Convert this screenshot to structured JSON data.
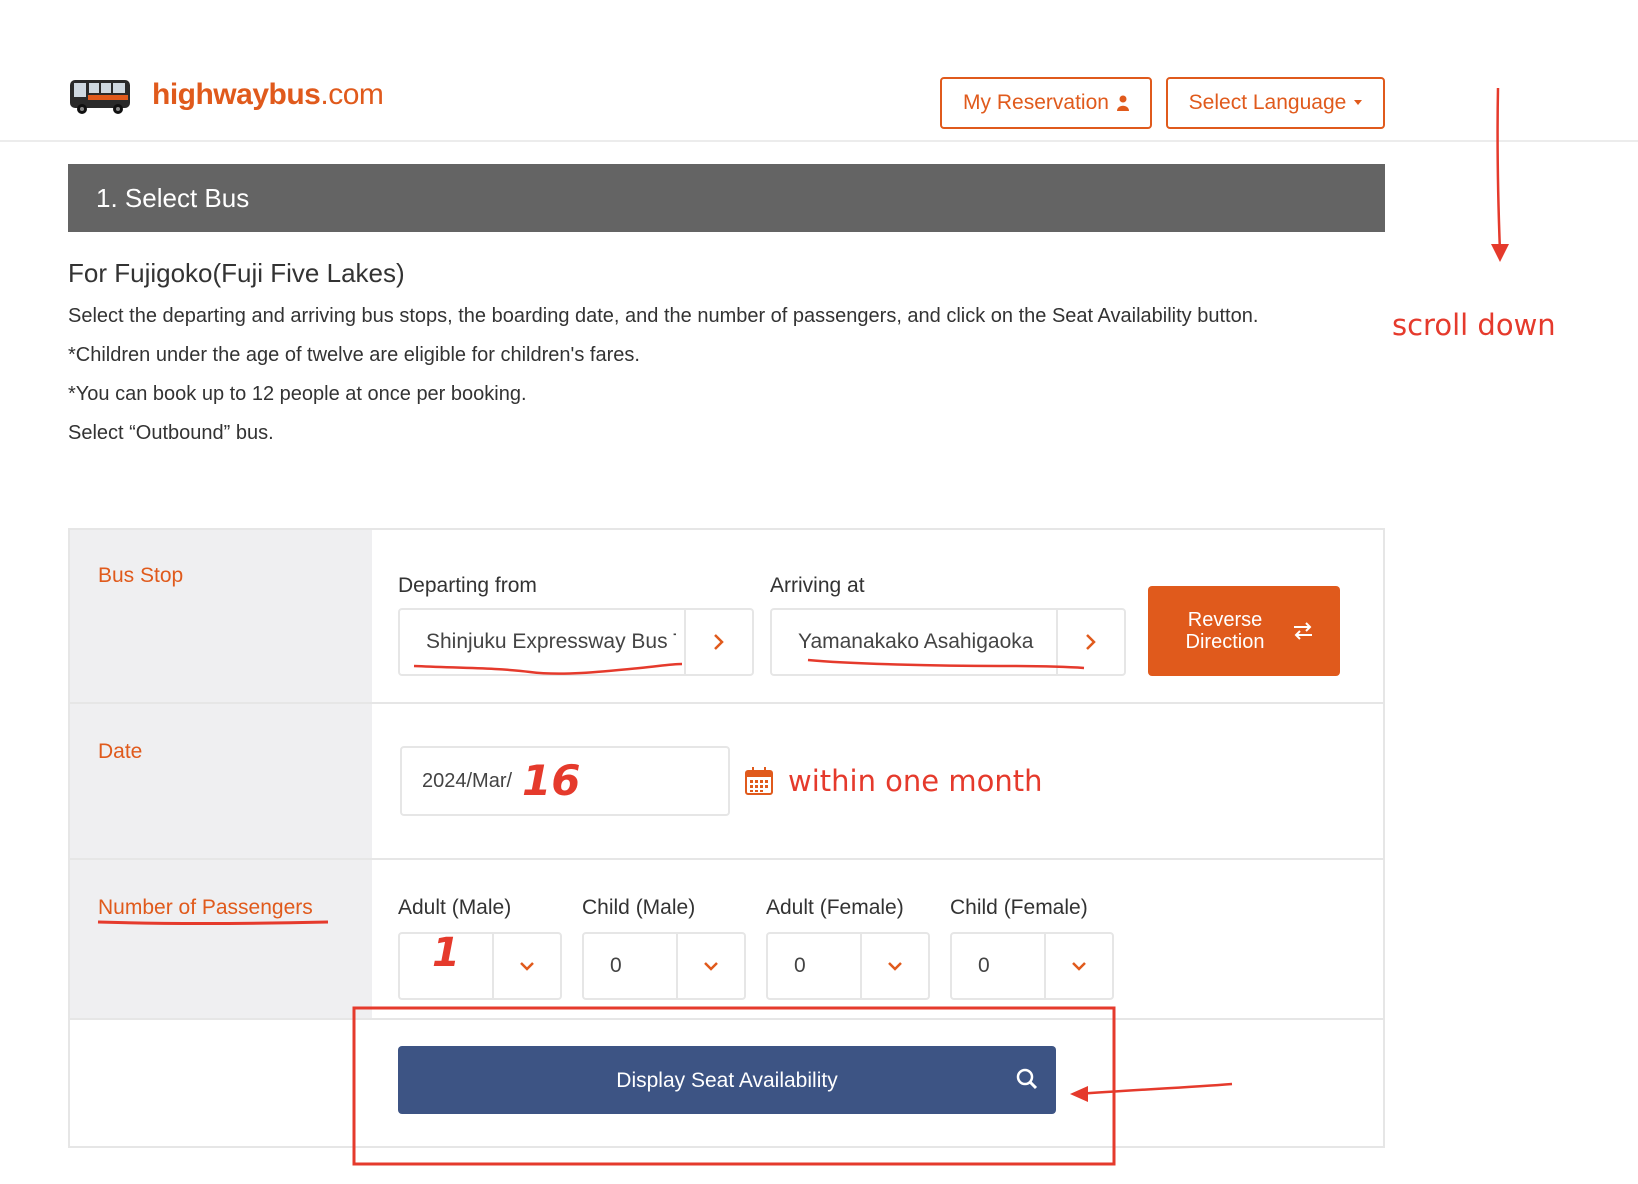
{
  "header": {
    "logo_text": "highwaybus",
    "logo_suffix": ".com",
    "reservation_label": "My Reservation",
    "language_label": "Select Language"
  },
  "section": {
    "title": "1. Select Bus"
  },
  "intro": {
    "title": "For Fujigoko(Fuji Five Lakes)",
    "lines": [
      "Select the departing and arriving bus stops, the boarding date, and the number of passengers, and click on the Seat Availability button.",
      "*Children under the age of twelve are eligible for children's fares.",
      "*You can book up to 12 people at once per booking.",
      "Select “Outbound” bus."
    ]
  },
  "form": {
    "bus_stop_label": "Bus Stop",
    "departing_label": "Departing from",
    "departing_value": "Shinjuku Expressway Bus Terminal",
    "arriving_label": "Arriving at",
    "arriving_value": "Yamanakako Asahigaoka",
    "reverse_label": "Reverse Direction",
    "date_label": "Date",
    "date_value": "2024/Mar/",
    "passengers_label": "Number of Passengers",
    "passengers": [
      {
        "label": "Adult (Male)",
        "value": ""
      },
      {
        "label": "Child (Male)",
        "value": "0"
      },
      {
        "label": "Adult (Female)",
        "value": "0"
      },
      {
        "label": "Child (Female)",
        "value": "0"
      }
    ],
    "display_button_label": "Display Seat Availability"
  },
  "annotations": {
    "scroll_text": "scroll down",
    "date_handwritten": "16",
    "date_note": "within one month",
    "adult_handwritten": "1"
  },
  "colors": {
    "brand_orange": "#e05a1c",
    "section_gray": "#646464",
    "button_navy": "#3d5484",
    "annotation_red": "#e53a2c"
  }
}
